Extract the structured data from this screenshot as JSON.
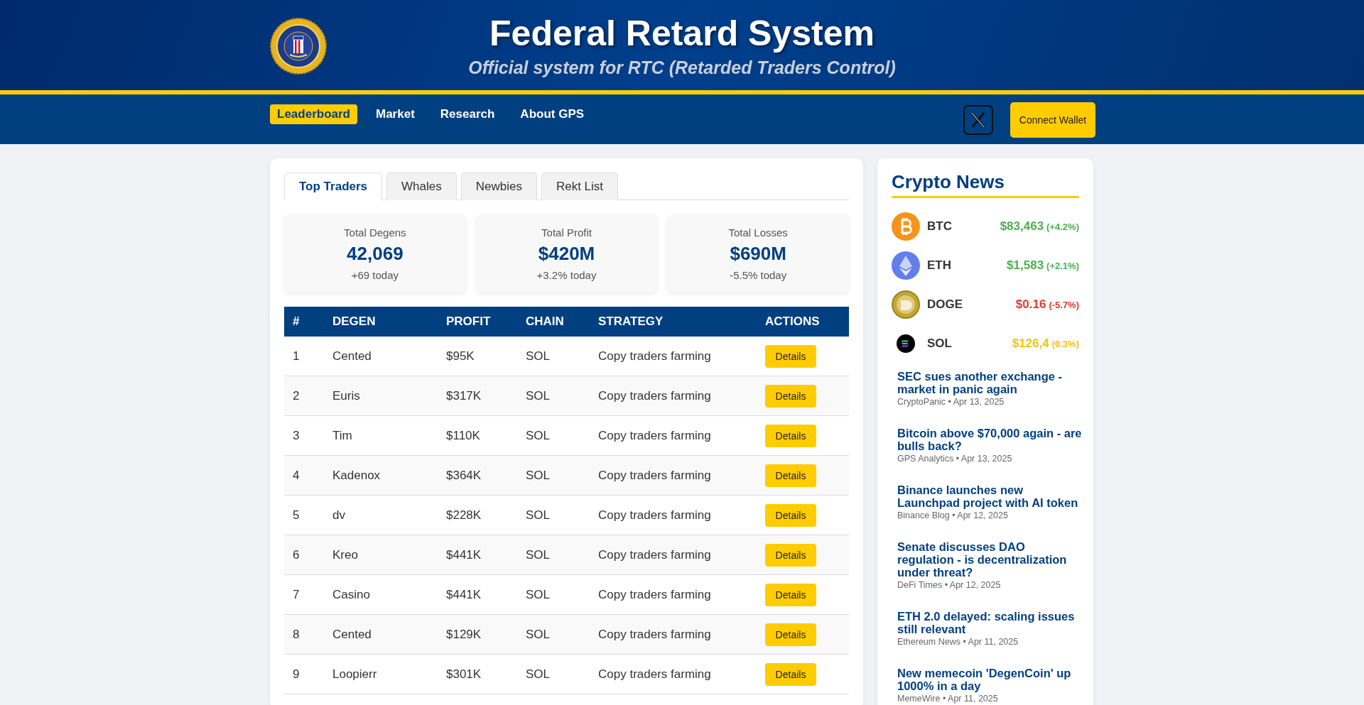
{
  "header": {
    "title": "Federal Retard System",
    "subtitle": "Official system for RTC (Retarded Traders Control)"
  },
  "nav": [
    {
      "label": "Leaderboard",
      "selected": true
    },
    {
      "label": "Market",
      "selected": false
    },
    {
      "label": "Research",
      "selected": false
    },
    {
      "label": "About GPS",
      "selected": false
    }
  ],
  "connect_button": "Connect Wallet",
  "tabs": [
    {
      "label": "Top Traders",
      "selected": true
    },
    {
      "label": "Whales",
      "selected": false
    },
    {
      "label": "Newbies",
      "selected": false
    },
    {
      "label": "Rekt List",
      "selected": false
    }
  ],
  "stats": [
    {
      "label": "Total Degens",
      "value": "42,069",
      "change": "+69 today"
    },
    {
      "label": "Total Profit",
      "value": "$420M",
      "change": "+3.2% today"
    },
    {
      "label": "Total Losses",
      "value": "$690M",
      "change": "-5.5% today"
    }
  ],
  "table": {
    "columns": [
      "#",
      "DEGEN",
      "PROFIT",
      "CHAIN",
      "STRATEGY",
      "ACTIONS"
    ],
    "rows": [
      {
        "rank": "1",
        "degen": "Cented",
        "profit": "$95K",
        "chain": "SOL",
        "strategy": "Copy traders farming",
        "action": "Details"
      },
      {
        "rank": "2",
        "degen": "Euris",
        "profit": "$317K",
        "chain": "SOL",
        "strategy": "Copy traders farming",
        "action": "Details"
      },
      {
        "rank": "3",
        "degen": "Tim",
        "profit": "$110K",
        "chain": "SOL",
        "strategy": "Copy traders farming",
        "action": "Details"
      },
      {
        "rank": "4",
        "degen": "Kadenox",
        "profit": "$364K",
        "chain": "SOL",
        "strategy": "Copy traders farming",
        "action": "Details"
      },
      {
        "rank": "5",
        "degen": "dv",
        "profit": "$228K",
        "chain": "SOL",
        "strategy": "Copy traders farming",
        "action": "Details"
      },
      {
        "rank": "6",
        "degen": "Kreo",
        "profit": "$441K",
        "chain": "SOL",
        "strategy": "Copy traders farming",
        "action": "Details"
      },
      {
        "rank": "7",
        "degen": "Casino",
        "profit": "$441K",
        "chain": "SOL",
        "strategy": "Copy traders farming",
        "action": "Details"
      },
      {
        "rank": "8",
        "degen": "Cented",
        "profit": "$129K",
        "chain": "SOL",
        "strategy": "Copy traders farming",
        "action": "Details"
      },
      {
        "rank": "9",
        "degen": "Loopierr",
        "profit": "$301K",
        "chain": "SOL",
        "strategy": "Copy traders farming",
        "action": "Details"
      }
    ]
  },
  "news": {
    "title": "Crypto News",
    "coins": [
      {
        "symbol": "BTC",
        "price": "$83,463",
        "change": "(+4.2%)",
        "color": "#4caf50"
      },
      {
        "symbol": "ETH",
        "price": "$1,583",
        "change": "(+2.1%)",
        "color": "#4caf50"
      },
      {
        "symbol": "DOGE",
        "price": "$0.16",
        "change": "(-5.7%)",
        "color": "#e53935"
      },
      {
        "symbol": "SOL",
        "price": "$126,4",
        "change": "(0.3%)",
        "color": "#f4c20d"
      }
    ],
    "articles": [
      {
        "headline": "SEC sues another exchange - market in panic again",
        "meta": "CryptoPanic • Apr 13, 2025"
      },
      {
        "headline": "Bitcoin above $70,000 again - are bulls back?",
        "meta": "GPS Analytics • Apr 13, 2025"
      },
      {
        "headline": "Binance launches new Launchpad project with AI token",
        "meta": "Binance Blog • Apr 12, 2025"
      },
      {
        "headline": "Senate discusses DAO regulation - is decentralization under threat?",
        "meta": "DeFi Times • Apr 12, 2025"
      },
      {
        "headline": "ETH 2.0 delayed: scaling issues still relevant",
        "meta": "Ethereum News • Apr 11, 2025"
      },
      {
        "headline": "New memecoin 'DegenCoin' up 1000% in a day",
        "meta": "MemeWire • Apr 11, 2025"
      }
    ]
  }
}
